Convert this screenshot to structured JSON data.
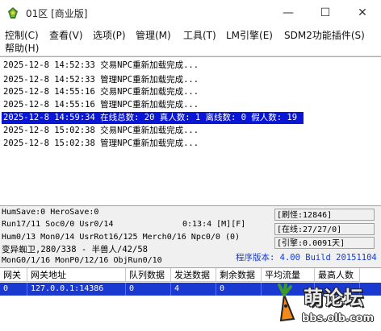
{
  "window": {
    "title": "01区 [商业版]",
    "controls": {
      "minimize": "—",
      "maximize": "☐",
      "close": "✕"
    }
  },
  "menu": {
    "items": [
      "控制(C)",
      "查看(V)",
      "选项(P)",
      "管理(M)",
      "工具(T)",
      "LM引擎(E)",
      "SDM2功能插件(S)",
      "帮助(H)"
    ]
  },
  "log": {
    "lines": [
      "2025-12-8 14:52:33 交易NPC重新加载完成...",
      "2025-12-8 14:52:33 管理NPC重新加载完成...",
      "2025-12-8 14:55:16 交易NPC重新加载完成...",
      "2025-12-8 14:55:16 管理NPC重新加载完成...",
      "2025-12-8 14:59:34 在线总数: 20 真人数: 1 离线数: 0 假人数: 19",
      "2025-12-8 15:02:38 交易NPC重新加载完成...",
      "2025-12-8 15:02:38 管理NPC重新加载完成..."
    ],
    "selected_index": 4
  },
  "stats": {
    "save": "HumSave:0 HeroSave:0",
    "run": "Run17/11 Soc0/0 Usr0/14",
    "clock": "0:13:4 [M][F]",
    "hum": "Hum0/13 Mon0/14 UsrRot16/125 Merch0/16 Npc0/0 (0)",
    "monster": "变异蜘卫,280/338 - 半兽人/42/58",
    "mon": "MonG0/1/16 MonP0/12/16 ObjRun0/10",
    "refresh": "[刷怪:12846]",
    "online": "[在线:27/27/0]",
    "engine": "[引擎:0.0091天]",
    "version": "程序版本: 4.00 Build 20151104"
  },
  "gateway_table": {
    "columns": [
      "网关",
      "网关地址",
      "队列数据",
      "发送数据",
      "剩余数据",
      "平均流量",
      "最高人数"
    ],
    "rows": [
      [
        "0",
        "127.0.0.1:14386",
        "0",
        "4",
        "0",
        "",
        ""
      ]
    ]
  },
  "watermark": {
    "main": "萌论坛",
    "url": "bbs.olb.com"
  }
}
